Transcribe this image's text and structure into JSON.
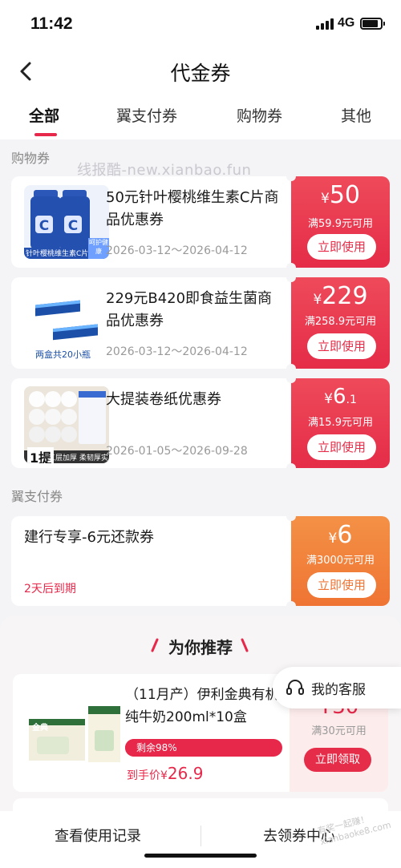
{
  "status_bar": {
    "time": "11:42",
    "network": "4G"
  },
  "header": {
    "title": "代金券"
  },
  "tabs": [
    {
      "label": "全部",
      "active": true
    },
    {
      "label": "翼支付券",
      "active": false
    },
    {
      "label": "购物券",
      "active": false
    },
    {
      "label": "其他",
      "active": false
    }
  ],
  "watermark": "线报酷-new.xianbao.fun",
  "sections": {
    "shopping": "购物券",
    "bestpay": "翼支付券"
  },
  "coupons": [
    {
      "title": "50元针叶樱桃维生素C片商品优惠券",
      "date_range": "2026-03-12～2026-04-12",
      "currency": "¥",
      "amount": "50",
      "condition": "满59.9元可用",
      "button": "立即使用",
      "thumb_text": "针叶樱桃维生素C片",
      "thumb_badge": "呵护健康",
      "color": "#e52c48"
    },
    {
      "title": "229元B420即食益生菌商品优惠券",
      "date_range": "2026-03-12～2026-04-12",
      "currency": "¥",
      "amount": "229",
      "condition": "满258.9元可用",
      "button": "立即使用",
      "thumb_text": "两盒共20小瓶",
      "color": "#e52c48"
    },
    {
      "title": "大提装卷纸优惠券",
      "date_range": "2026-01-05～2026-09-28",
      "currency": "¥",
      "amount": "6",
      "amount_decimal": ".1",
      "condition": "满15.9元可用",
      "button": "立即使用",
      "thumb_text": "1提",
      "thumb_badge": "五层加厚 柔韧厚实",
      "color": "#e52c48"
    },
    {
      "title": "建行专享-6元还款券",
      "expire_note": "2天后到期",
      "currency": "¥",
      "amount": "6",
      "condition": "满3000元可用",
      "button": "立即使用",
      "color": "#ef7433"
    }
  ],
  "recommend": {
    "heading": "为你推荐",
    "item": {
      "title": "（11月产）伊利金典有机纯牛奶200ml*10盒",
      "remaining_label": "剩余98%",
      "remaining_fraction": 0.98,
      "price_prefix": "到手价",
      "price_currency": "¥",
      "price": "26.9",
      "coupon_amount": "¥30",
      "coupon_condition": "满30元可用",
      "button": "立即领取",
      "thumb_brand": "金典"
    }
  },
  "service": {
    "label": "我的客服"
  },
  "bottom_bar": {
    "left": "查看使用记录",
    "right": "去领券中心"
  },
  "corner_watermark": "有奖一起赚！ xianbaoke8.com"
}
